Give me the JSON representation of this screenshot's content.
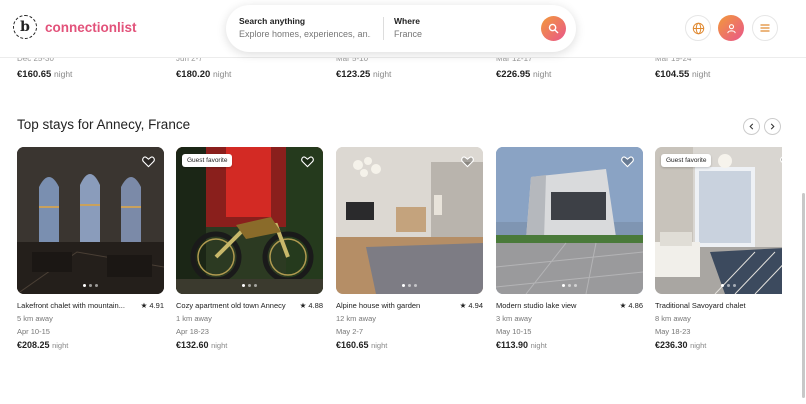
{
  "header": {
    "logo_letter": "b",
    "brand": "connectionlist",
    "search": {
      "anything_label": "Search anything",
      "anything_value": "Explore homes, experiences, an...",
      "where_label": "Where",
      "where_value": "France"
    },
    "icons": [
      "globe-icon",
      "user-icon",
      "menu-icon"
    ]
  },
  "previous_row": [
    {
      "date": "Dec 25-30",
      "price": "€160.65",
      "night": "night"
    },
    {
      "date": "Jun 2-7",
      "price": "€180.20",
      "night": "night"
    },
    {
      "date": "Mar 5-10",
      "price": "€123.25",
      "night": "night"
    },
    {
      "date": "Mar 12-17",
      "price": "€226.95",
      "night": "night"
    },
    {
      "date": "Mar 19-24",
      "price": "€104.55",
      "night": "night"
    }
  ],
  "section": {
    "title": "Top stays for Annecy, France",
    "cards": [
      {
        "name": "Lakefront chalet with mountain...",
        "rating": "4.91",
        "distance": "5 km away",
        "dates": "Apr 10-15",
        "price": "€208.25",
        "night": "night",
        "badge": ""
      },
      {
        "name": "Cozy apartment old town Annecy",
        "rating": "4.88",
        "distance": "1 km away",
        "dates": "Apr 18-23",
        "price": "€132.60",
        "night": "night",
        "badge": "Guest favorite"
      },
      {
        "name": "Alpine house with garden",
        "rating": "4.94",
        "distance": "12 km away",
        "dates": "May 2-7",
        "price": "€160.65",
        "night": "night",
        "badge": ""
      },
      {
        "name": "Modern studio lake view",
        "rating": "4.86",
        "distance": "3 km away",
        "dates": "May 10-15",
        "price": "€113.90",
        "night": "night",
        "badge": ""
      },
      {
        "name": "Traditional Savoyard chalet",
        "rating": "",
        "distance": "8 km away",
        "dates": "May 18-23",
        "price": "€236.30",
        "night": "night",
        "badge": "Guest favorite"
      }
    ]
  },
  "colors": {
    "brand": "#e2527a",
    "gradient_start": "#f29a3a",
    "gradient_end": "#e9558b"
  }
}
